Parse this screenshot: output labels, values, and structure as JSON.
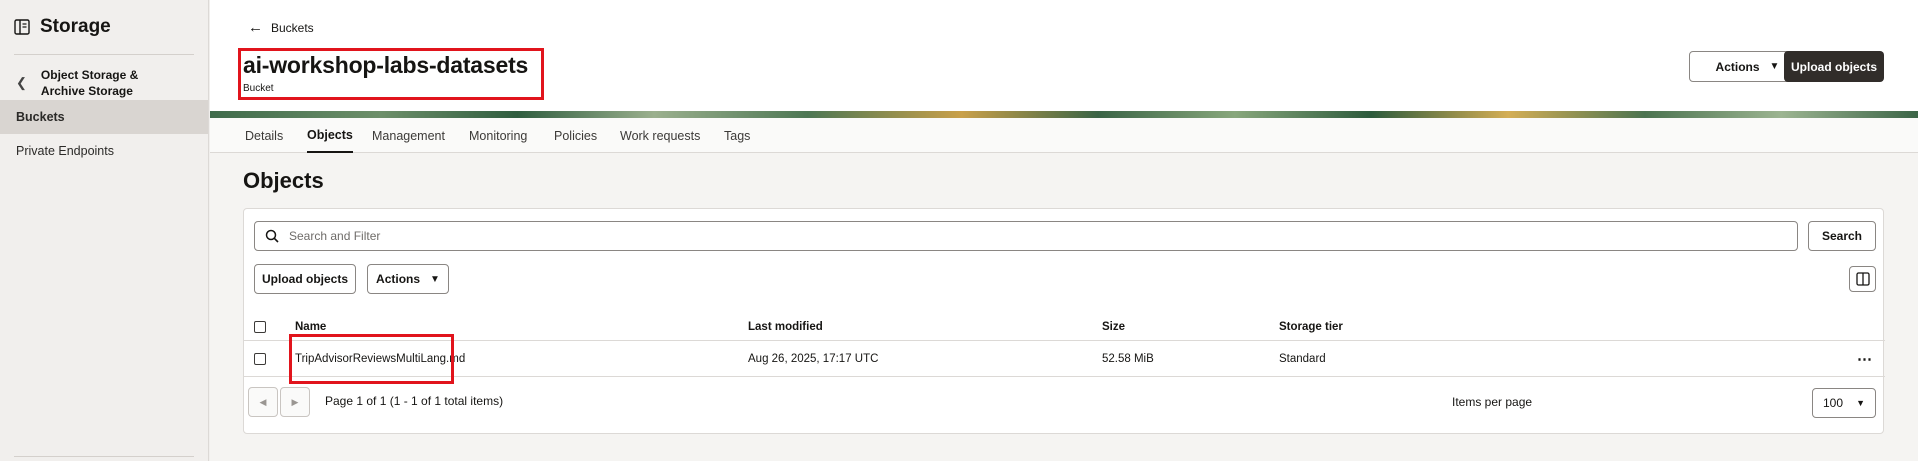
{
  "sidebar": {
    "title": "Storage",
    "back_label": "Object Storage & Archive Storage",
    "items": [
      {
        "label": "Buckets",
        "active": true
      },
      {
        "label": "Private Endpoints",
        "active": false
      }
    ]
  },
  "header": {
    "back_label": "Buckets",
    "bucket_name": "ai-workshop-labs-datasets",
    "bucket_type": "Bucket",
    "actions_label": "Actions",
    "upload_label": "Upload objects"
  },
  "tabs": [
    "Details",
    "Objects",
    "Management",
    "Monitoring",
    "Policies",
    "Work requests",
    "Tags"
  ],
  "active_tab": "Objects",
  "objects": {
    "heading": "Objects",
    "search_placeholder": "Search and Filter",
    "search_button": "Search",
    "upload_label": "Upload objects",
    "actions_label": "Actions",
    "columns": {
      "name": "Name",
      "modified": "Last modified",
      "size": "Size",
      "tier": "Storage tier"
    },
    "rows": [
      {
        "name": "TripAdvisorReviewsMultiLang.md",
        "modified": "Aug 26, 2025, 17:17 UTC",
        "size": "52.58 MiB",
        "tier": "Standard"
      }
    ],
    "pagination": "Page 1 of 1 (1 - 1 of 1 total items)",
    "items_per_page_label": "Items per page",
    "items_per_page": "100"
  },
  "colors": {
    "accent_dark": "#312d2a",
    "highlight": "#e1141c"
  }
}
